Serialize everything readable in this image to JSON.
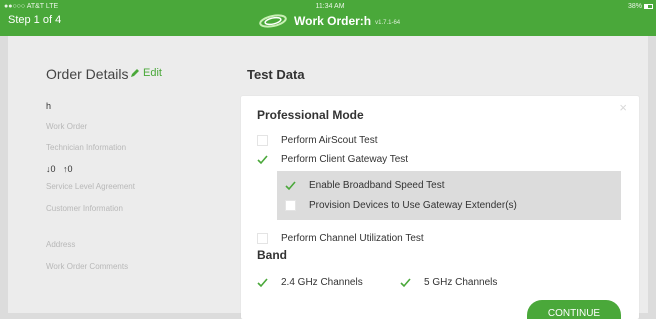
{
  "statusbar": {
    "carrier": "●●○○○ AT&T  LTE",
    "time": "11:34 AM",
    "battery": "38%"
  },
  "header": {
    "step": "Step 1 of 4",
    "title": "Work Order:h",
    "version": "v1.7.1-64",
    "logo_icon": "swirl-logo-icon"
  },
  "left": {
    "title": "Order Details",
    "edit_label": "Edit",
    "work_order_value": "h",
    "work_order_label": "Work Order",
    "technician_label": "Technician Information",
    "sla_down": "↓0",
    "sla_up": "↑0",
    "sla_label": "Service Level Agreement",
    "customer_label": "Customer Information",
    "address_label": "Address",
    "comments_label": "Work Order Comments"
  },
  "right": {
    "title": "Test Data",
    "card": {
      "close": "×",
      "title": "Professional Mode",
      "options": [
        {
          "label": "Perform AirScout Test",
          "checked": false
        },
        {
          "label": "Perform Client Gateway Test",
          "checked": true
        },
        {
          "label": "Enable Broadband Speed Test",
          "checked": true
        },
        {
          "label": "Provision Devices to Use Gateway Extender(s)",
          "checked": false
        },
        {
          "label": "Perform Channel Utilization Test",
          "checked": false
        }
      ],
      "band_title": "Band",
      "bands": [
        {
          "label": "2.4 GHz Channels",
          "checked": true
        },
        {
          "label": "5 GHz Channels",
          "checked": true
        }
      ],
      "continue_label": "CONTINUE"
    }
  },
  "colors": {
    "brand_green": "#4aa83a",
    "background": "#ececec",
    "sub_panel": "#dcdcdc"
  }
}
